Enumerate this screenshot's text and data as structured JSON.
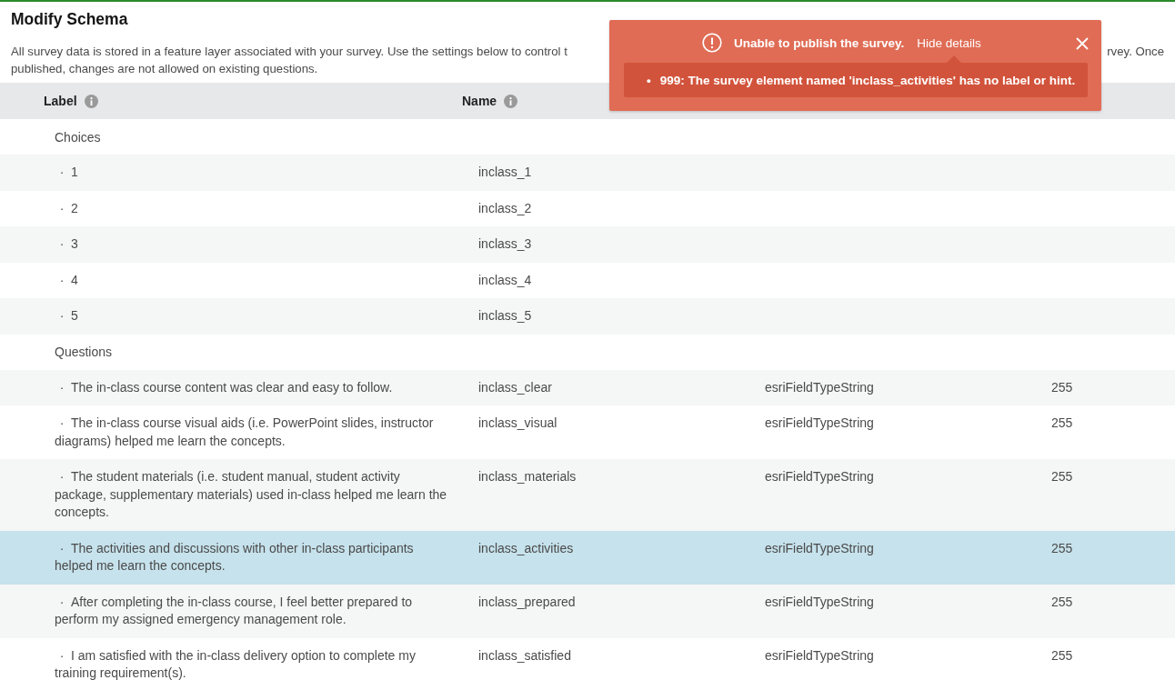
{
  "page": {
    "title": "Modify Schema",
    "description_line1_start": "All survey data is stored in a feature layer associated with your survey. Use the settings below to control t",
    "description_line1_end": "rvey. Once",
    "description_line2": "published, changes are not allowed on existing questions."
  },
  "table": {
    "columns": [
      {
        "label": "Label",
        "info": true
      },
      {
        "label": "Name",
        "info": true
      }
    ],
    "groups": [
      {
        "label": "Choices",
        "rows": [
          {
            "bullet": "·",
            "label": "1",
            "name": "inclass_1",
            "selected": false
          },
          {
            "bullet": "·",
            "label": "2",
            "name": "inclass_2",
            "selected": false
          },
          {
            "bullet": "·",
            "label": "3",
            "name": "inclass_3",
            "selected": false
          },
          {
            "bullet": "·",
            "label": "4",
            "name": "inclass_4",
            "selected": false
          },
          {
            "bullet": "·",
            "label": "5",
            "name": "inclass_5",
            "selected": false
          }
        ]
      },
      {
        "label": "Questions",
        "rows": [
          {
            "bullet": "·",
            "label": "The in-class course content was clear and easy to follow.",
            "name": "inclass_clear",
            "field_type": "esriFieldTypeString",
            "field_length": "255",
            "selected": false
          },
          {
            "bullet": "·",
            "label": "The in-class course visual aids (i.e. PowerPoint slides, instructor diagrams) helped me learn the concepts.",
            "name": "inclass_visual",
            "field_type": "esriFieldTypeString",
            "field_length": "255",
            "selected": false
          },
          {
            "bullet": "·",
            "label": "The student materials (i.e. student manual, student activity package, supplementary materials) used in-class helped me learn the concepts.",
            "name": "inclass_materials",
            "field_type": "esriFieldTypeString",
            "field_length": "255",
            "selected": false
          },
          {
            "bullet": "·",
            "label": "The activities and discussions with other in-class participants helped me learn the concepts.",
            "name": "inclass_activities",
            "field_type": "esriFieldTypeString",
            "field_length": "255",
            "selected": true
          },
          {
            "bullet": "·",
            "label": "After completing the in-class course, I feel better prepared to perform my assigned emergency management role.",
            "name": "inclass_prepared",
            "field_type": "esriFieldTypeString",
            "field_length": "255",
            "selected": false
          },
          {
            "bullet": "·",
            "label": "I am satisfied with the in-class delivery option to complete my training requirement(s).",
            "name": "inclass_satisfied",
            "field_type": "esriFieldTypeString",
            "field_length": "255",
            "selected": false
          }
        ]
      }
    ]
  },
  "error_toast": {
    "message": "Unable to publish the survey.",
    "details_link": "Hide details",
    "details_expanded": true,
    "details": [
      {
        "bullet": "•",
        "text": "999: The survey element named 'inclass_activities' has no label or hint."
      }
    ]
  }
}
